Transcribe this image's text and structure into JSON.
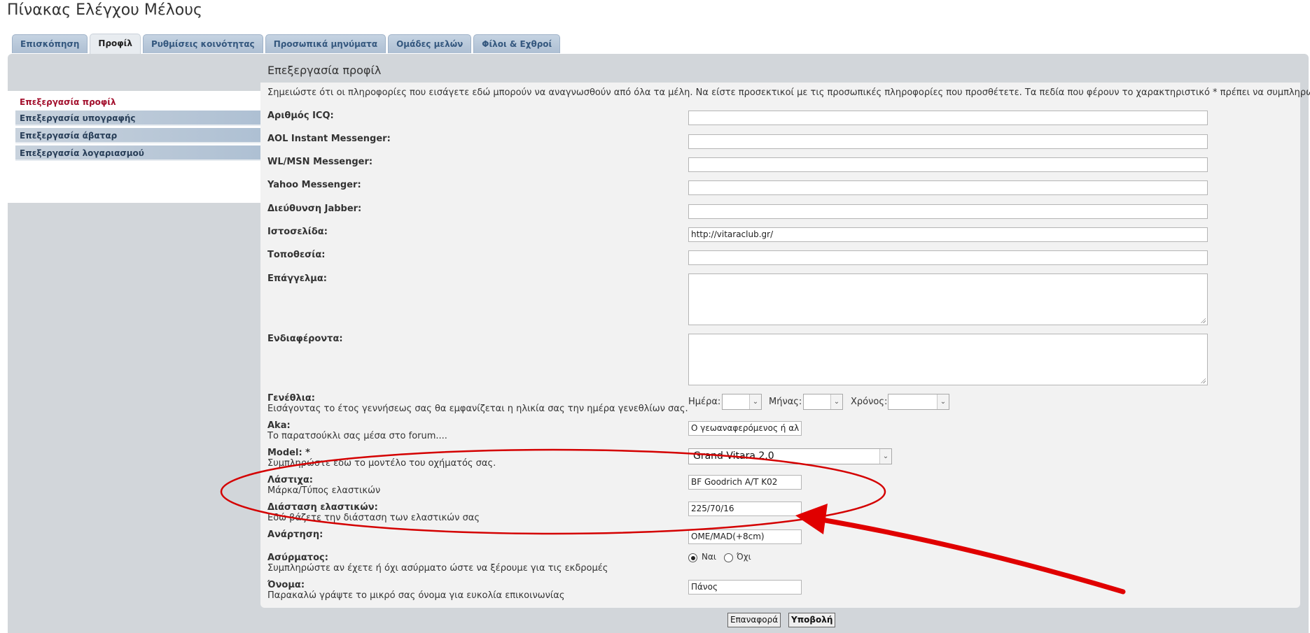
{
  "page_title": "Πίνακας Ελέγχου Μέλους",
  "tabs": [
    {
      "label": "Επισκόπηση"
    },
    {
      "label": "Προφίλ",
      "active": true
    },
    {
      "label": "Ρυθμίσεις κοινότητας"
    },
    {
      "label": "Προσωπικά μηνύματα"
    },
    {
      "label": "Ομάδες μελών"
    },
    {
      "label": "Φίλοι & Εχθροί"
    }
  ],
  "sidebar": {
    "items": [
      {
        "label": "Επεξεργασία προφίλ",
        "active": true
      },
      {
        "label": "Επεξεργασία υπογραφής"
      },
      {
        "label": "Επεξεργασία άβαταρ"
      },
      {
        "label": "Επεξεργασία λογαριασμού"
      }
    ]
  },
  "content": {
    "title": "Επεξεργασία προφίλ",
    "notice": "Σημειώστε ότι οι πληροφορίες που εισάγετε εδώ μπορούν να αναγνωσθούν από όλα τα μέλη. Να είστε προσεκτικοί με τις προσωπικές πληροφορίες που προσθέτετε. Τα πεδία που φέρουν το χαρακτηριστικό * πρέπει να συμπληρωθούν."
  },
  "fields": {
    "icq": {
      "label": "Αριθμός ICQ:",
      "value": ""
    },
    "aol": {
      "label": "AOL Instant Messenger:",
      "value": ""
    },
    "msn": {
      "label": "WL/MSN Messenger:",
      "value": ""
    },
    "yahoo": {
      "label": "Yahoo Messenger:",
      "value": ""
    },
    "jabber": {
      "label": "Διεύθυνση Jabber:",
      "value": ""
    },
    "website": {
      "label": "Ιστοσελίδα:",
      "value": "http://vitaraclub.gr/"
    },
    "location": {
      "label": "Τοποθεσία:",
      "value": ""
    },
    "occupation": {
      "label": "Επάγγελμα:",
      "value": ""
    },
    "interests": {
      "label": "Ενδιαφέροντα:",
      "value": ""
    },
    "birthday": {
      "label": "Γενέθλια:",
      "desc": "Εισάγοντας το έτος γεννήσεως σας θα εμφανίζεται η ηλικία σας την ημέρα γενεθλίων σας.",
      "day_label": "Ημέρα:",
      "month_label": "Μήνας:",
      "year_label": "Χρόνος:",
      "day_value": "",
      "month_value": "",
      "year_value": ""
    },
    "aka": {
      "label": "Aka:",
      "desc": "Το παρατσούκλι σας μέσα στο forum....",
      "value": "Ο γεωαναφερόμενος ή αλ"
    },
    "model": {
      "label": "Model: *",
      "desc": "Συμπληρώστε εδώ το μοντέλο του οχήματός σας.",
      "value": "Grand Vitara 2.0"
    },
    "tyres": {
      "label": "Λάστιχα:",
      "desc": "Μάρκα/Τύπος ελαστικών",
      "value": "BF Goodrich A/T K02"
    },
    "tyre_size": {
      "label": "Διάσταση ελαστικών:",
      "desc": "Εδώ βάζετε την διάσταση των ελαστικών σας",
      "value": "225/70/16"
    },
    "suspension": {
      "label": "Ανάρτηση:",
      "value": "OME/MAD(+8cm)"
    },
    "radio": {
      "label": "Ασύρματος:",
      "desc": "Συμπληρώστε αν έχετε ή όχι ασύρματο ώστε να ξέρουμε για τις εκδρομές",
      "yes_label": "Ναι",
      "no_label": "Όχι",
      "selected": "yes"
    },
    "name": {
      "label": "Όνομα:",
      "desc": "Παρακαλώ γράψτε το μικρό σας όνομα για ευκολία επικοινωνίας",
      "value": "Πάνος"
    }
  },
  "buttons": {
    "reset": "Επαναφορά",
    "submit": "Υποβολή"
  },
  "annotation": {
    "color": "#d40000"
  }
}
